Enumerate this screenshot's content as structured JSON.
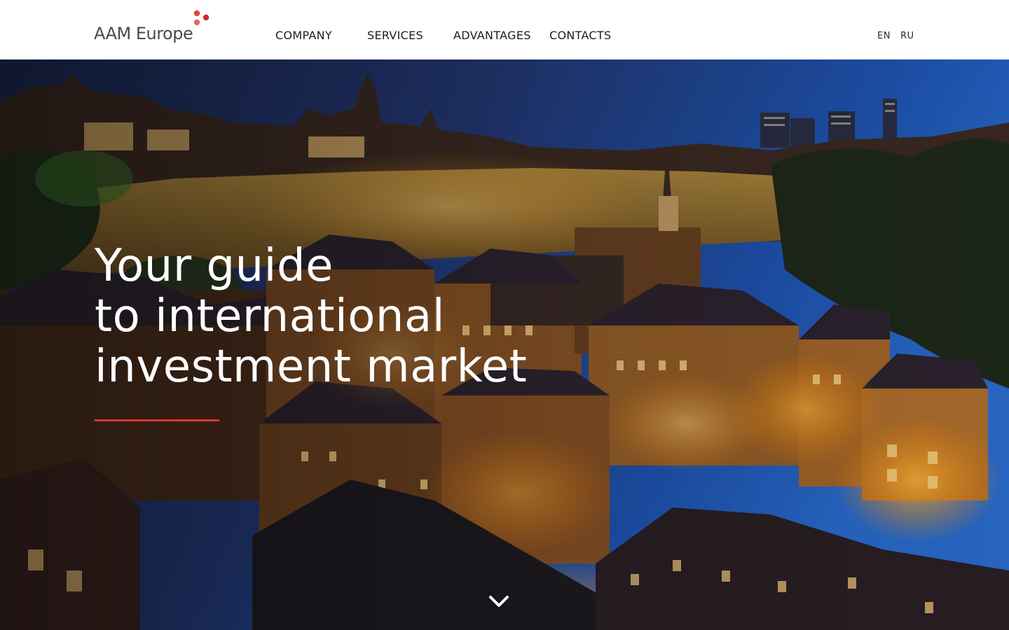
{
  "brand": {
    "name": "AAM Europe",
    "dot_colors": [
      "#e0463d",
      "#c9302c",
      "#e66a5f"
    ]
  },
  "nav": {
    "items": [
      {
        "label": "COMPANY"
      },
      {
        "label": "SERVICES"
      },
      {
        "label": "ADVANTAGES"
      },
      {
        "label": "CONTACTS"
      }
    ]
  },
  "languages": [
    {
      "label": "EN"
    },
    {
      "label": "RU"
    }
  ],
  "hero": {
    "title_lines": [
      "Your guide",
      "to international",
      "investment market"
    ],
    "accent_color": "#e2352b",
    "scroll_icon": "chevron-down-icon"
  }
}
